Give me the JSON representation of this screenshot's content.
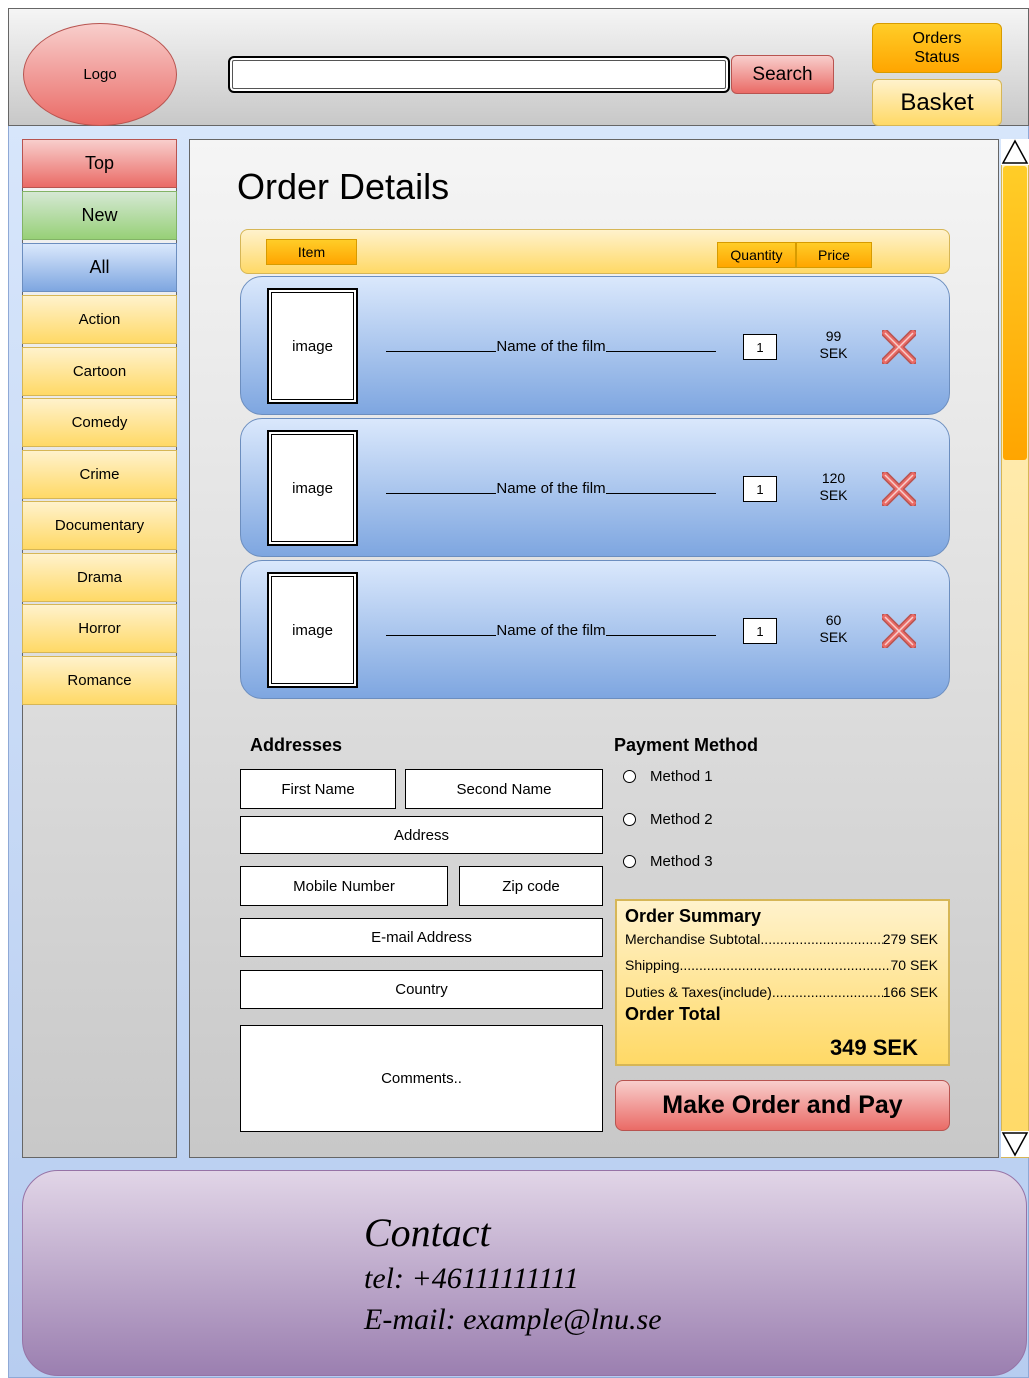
{
  "header": {
    "logo": "Logo",
    "search_value": "",
    "search_button": "Search",
    "orders_status": "Orders Status",
    "basket": "Basket"
  },
  "sidebar": {
    "items": [
      {
        "label": "Top"
      },
      {
        "label": "New"
      },
      {
        "label": "All"
      },
      {
        "label": "Action"
      },
      {
        "label": "Cartoon"
      },
      {
        "label": "Comedy"
      },
      {
        "label": "Crime"
      },
      {
        "label": "Documentary"
      },
      {
        "label": "Drama"
      },
      {
        "label": "Horror"
      },
      {
        "label": "Romance"
      }
    ]
  },
  "main": {
    "title": "Order Details",
    "columns": {
      "item": "Item",
      "quantity": "Quantity",
      "price": "Price"
    },
    "items": [
      {
        "image": "image",
        "name": "Name of the film",
        "quantity": "1",
        "price_value": "99",
        "price_unit": "SEK"
      },
      {
        "image": "image",
        "name": "Name of the film",
        "quantity": "1",
        "price_value": "120",
        "price_unit": "SEK"
      },
      {
        "image": "image",
        "name": "Name of the film",
        "quantity": "1",
        "price_value": "60",
        "price_unit": "SEK"
      }
    ]
  },
  "addresses": {
    "title": "Addresses",
    "first_name": "First Name",
    "second_name": "Second Name",
    "address": "Address",
    "mobile": "Mobile Number",
    "zip": "Zip code",
    "email": "E-mail Address",
    "country": "Country",
    "comments": "Comments.."
  },
  "payment": {
    "title": "Payment Method",
    "methods": [
      "Method 1",
      "Method 2",
      "Method 3"
    ]
  },
  "summary": {
    "title": "Order Summary",
    "subtotal_label": "Merchandise Subtotal",
    "subtotal_value": "279 SEK",
    "shipping_label": "Shipping",
    "shipping_value": "70 SEK",
    "duties_label": "Duties & Taxes(include)",
    "duties_value": "166 SEK",
    "total_label": "Order Total",
    "total_value": "349 SEK"
  },
  "actions": {
    "make_order": "Make Order and Pay"
  },
  "footer": {
    "title": "Contact",
    "tel": "tel: +46111111111",
    "email": "E-mail: example@lnu.se"
  },
  "colors": {
    "red_fill": "#ea6b66",
    "green_fill": "#97d077",
    "blue_fill": "#7ea6e0",
    "yellow_fill": "#ffd966",
    "orange_fill": "#ffa500",
    "purple_fill": "#9b7fb0"
  },
  "icons": {
    "remove": "close-x-icon",
    "scroll_up": "triangle-up-icon",
    "scroll_down": "triangle-down-icon"
  }
}
